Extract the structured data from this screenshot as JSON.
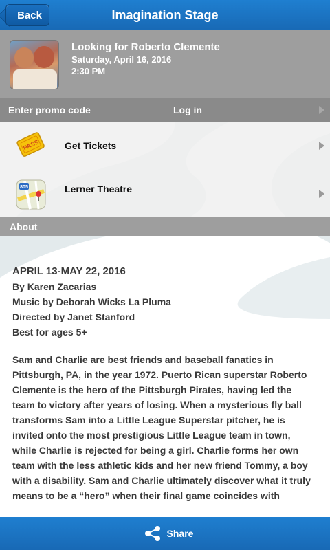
{
  "header": {
    "back_label": "Back",
    "title": "Imagination Stage"
  },
  "event": {
    "title": "Looking for Roberto Clemente",
    "date": "Saturday, April 16, 2016",
    "time": "2:30 PM"
  },
  "actions": {
    "promo_label": "Enter promo code",
    "login_label": "Log in"
  },
  "list": {
    "tickets_label": "Get Tickets",
    "tickets_icon": "pass-ticket-icon",
    "theatre_label": "Lerner Theatre",
    "theatre_icon": "map-icon"
  },
  "about": {
    "header": "About",
    "dates": "APRIL 13-MAY 22, 2016",
    "author": "By Karen Zacarias",
    "music": "Music by Deborah Wicks La Pluma",
    "director": "Directed by Janet Stanford",
    "ages": "Best for ages 5+",
    "description": "Sam and Charlie are best friends and baseball fanatics in Pittsburgh, PA, in the year 1972. Puerto Rican superstar Roberto Clemente is the hero of the Pittsburgh Pirates, having led the team to victory after years of losing. When a mysterious fly ball transforms Sam into a Little League Superstar pitcher, he is invited onto the most prestigious Little League team in town, while Charlie is rejected for being a girl. Charlie forms her own team with the less athletic kids and her new friend Tommy, a boy with a disability. Sam and Charlie ultimately discover what it truly means to be a “hero” when their final game coincides with"
  },
  "footer": {
    "share_label": "Share",
    "share_icon": "share-icon"
  },
  "colors": {
    "accent": "#1869b5",
    "header_gray": "#9e9e9e",
    "body_text": "#3a3a3a"
  }
}
